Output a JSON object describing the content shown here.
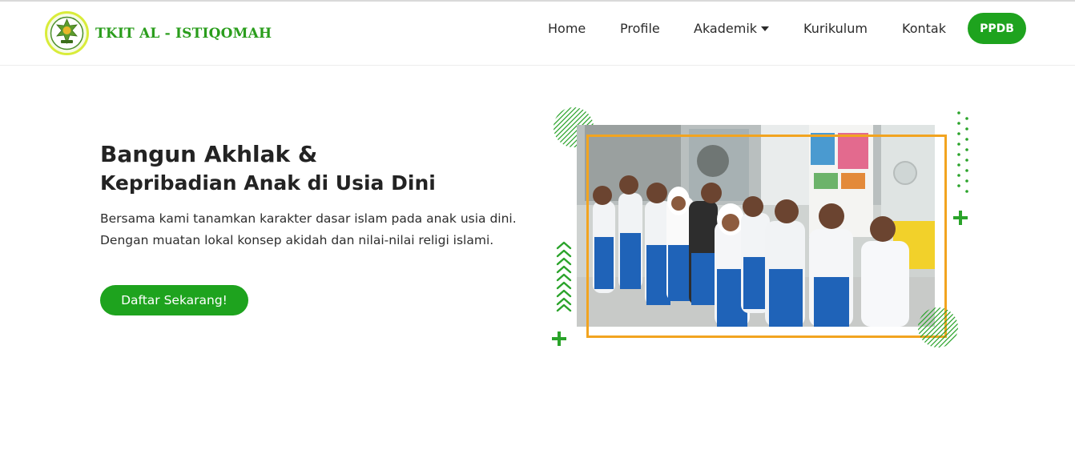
{
  "header": {
    "brand": "TKIT AL - ISTIQOMAH",
    "logo_icon": "school-emblem-icon",
    "nav": [
      {
        "label": "Home"
      },
      {
        "label": "Profile"
      },
      {
        "label": "Akademik",
        "has_dropdown": true
      },
      {
        "label": "Kurikulum"
      },
      {
        "label": "Kontak"
      }
    ],
    "cta_label": "PPDB"
  },
  "hero": {
    "title_line1": "Bangun Akhlak &",
    "title_line2": "Kepribadian Anak di Usia Dini",
    "description": "Bersama kami tanamkan karakter dasar islam pada anak usia dini. Dengan muatan lokal konsep akidah dan nilai-nilai religi islami.",
    "button_label": "Daftar Sekarang!"
  },
  "colors": {
    "brand_green": "#1ea31e",
    "brand_text_green": "#2a9d1c",
    "frame_orange": "#f2a420"
  }
}
